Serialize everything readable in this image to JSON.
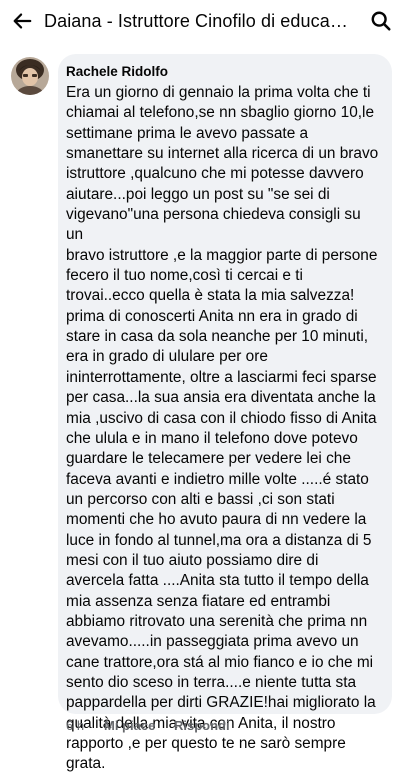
{
  "header": {
    "title": "Daiana - Istruttore Cinofilo di educazio...",
    "back_icon": "arrow-left-icon",
    "search_icon": "search-icon"
  },
  "comment": {
    "author": "Rachele Ridolfo",
    "text": "Era un giorno di gennaio la prima volta che ti\nchiamai al telefono,se nn sbaglio giorno 10,le\nsettimane prima le avevo  passate a\nsmanettare su internet alla ricerca di un bravo\nistruttore ,qualcuno che mi potesse davvero\naiutare...poi leggo un post su \"se sei di\nvigevano\"una persona chiedeva consigli su un\nbravo istruttore ,e la maggior parte di persone\nfecero il tuo nome,così ti cercai e ti\ntrovai..ecco quella è stata la mia salvezza!\nprima di conoscerti Anita nn era in grado di\nstare in casa da sola neanche per 10 minuti,\nera in grado di ululare per ore\nininterrottamente, oltre a lasciarmi feci sparse\nper casa...la sua ansia era diventata anche la\nmia ,uscivo di casa con il chiodo  fisso di Anita\nche ulula e in mano il telefono dove potevo\nguardare le telecamere per vedere lei che\nfaceva avanti e indietro mille volte .....é stato\nun percorso con alti e bassi ,ci son stati\nmomenti che ho avuto paura di nn vedere la\nluce in fondo al tunnel,ma ora a distanza di 5\nmesi  con il tuo aiuto possiamo dire di\navercela fatta ....Anita sta tutto il tempo della\nmia assenza senza fiatare ed entrambi\nabbiamo ritrovato una serenità che prima nn\navevamo.....in passeggiata prima avevo un\ncane trattore,ora stá  al mio fianco e io che mi\nsento dio sceso in terra....e niente tutta sta\npappardella per dirti GRAZIE!hai migliorato la\nqualità della mia vita con Anita, il nostro\nrapporto ,e per questo te ne sarò sempre\ngrata.",
    "time": "6 h",
    "like_label": "Mi piace",
    "reply_label": "Rispondi"
  }
}
